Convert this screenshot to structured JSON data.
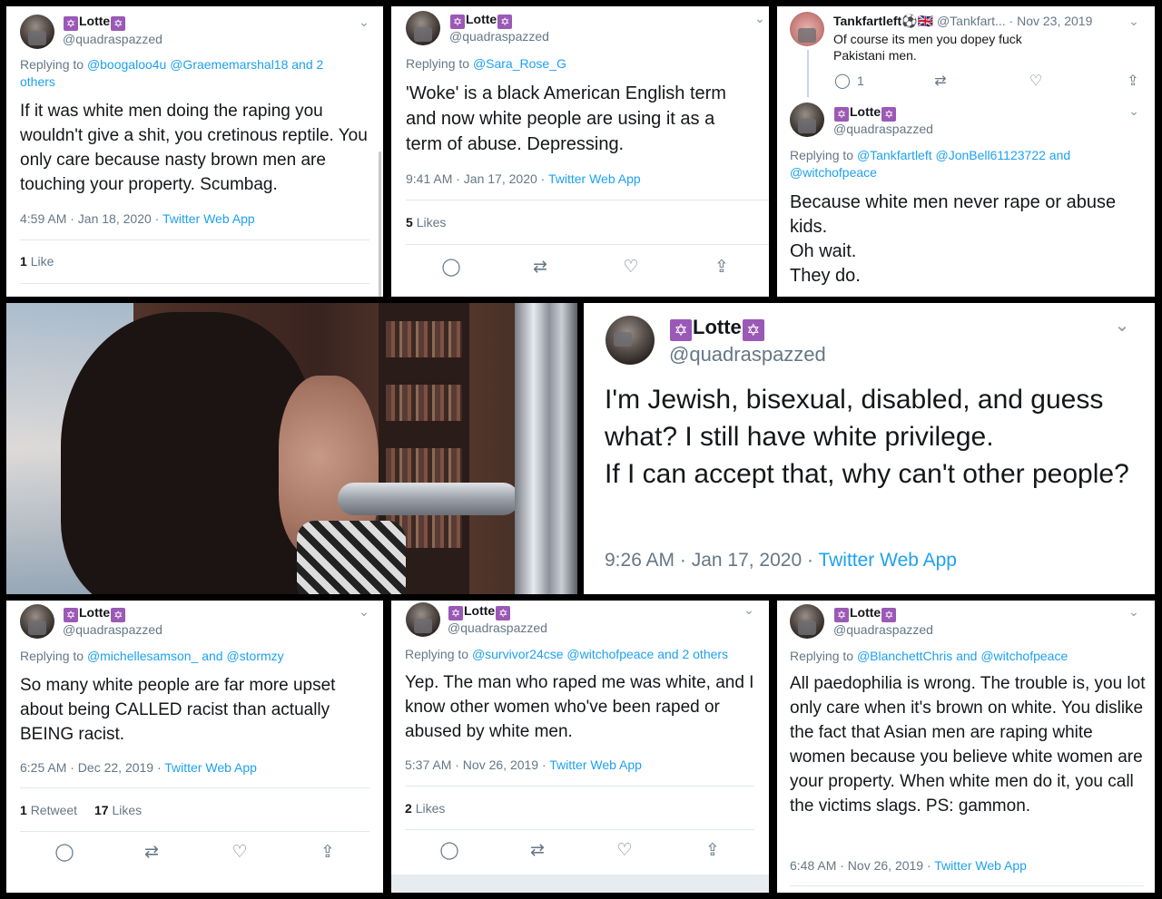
{
  "colors": {
    "link": "#1da1f2",
    "muted": "#657786",
    "text": "#14171a",
    "star_badge": "#9b59b6"
  },
  "profile": {
    "name": "Lotte",
    "handle": "@quadraspazzed",
    "star": "✡"
  },
  "tweets": {
    "t1": {
      "reply_prefix": "Replying to",
      "reply_to": "@boogaloo4u @Graememarshal18 and 2 others",
      "text": "If it was white men doing the raping you wouldn't give a shit, you cretinous reptile. You only care because nasty brown men are touching your property. Scumbag.",
      "time": "4:59 AM · Jan 18, 2020 ·",
      "app": "Twitter Web App",
      "likes_count": "1",
      "likes_label": "Like"
    },
    "t2": {
      "reply_prefix": "Replying to",
      "reply_to": "@Sara_Rose_G",
      "text": "'Woke' is a black American English term and now white people are using it as a term of abuse. Depressing.",
      "time": "9:41 AM · Jan 17, 2020 ·",
      "app": "Twitter Web App",
      "likes_count": "5",
      "likes_label": "Likes"
    },
    "t3": {
      "parent_name": "Tankfartleft",
      "parent_flags": "⚽🇬🇧",
      "parent_handle": "@Tankfart...",
      "parent_date": "· Nov 23, 2019",
      "parent_text": "Of course its men you dopey fuck Pakistani men.",
      "parent_reply_count": "1",
      "reply_prefix": "Replying to",
      "reply_to": "@Tankfartleft @JonBell61123722 and @witchofpeace",
      "text_lines": [
        "Because white men never rape or abuse kids.",
        "Oh wait.",
        "They do."
      ]
    },
    "t4": {
      "text_lines": [
        "I'm Jewish, bisexual, disabled, and guess what? I still have white privilege.",
        "If I can accept that, why can't other people?"
      ],
      "time": "9:26 AM · Jan 17, 2020 ·",
      "app": "Twitter Web App"
    },
    "t5": {
      "reply_prefix": "Replying to",
      "reply_to": "@michellesamson_ and @stormzy",
      "text": "So many white people are far more upset about being CALLED racist than actually BEING racist.",
      "time": "6:25 AM · Dec 22, 2019 ·",
      "app": "Twitter Web App",
      "retweets_count": "1",
      "retweets_label": "Retweet",
      "likes_count": "17",
      "likes_label": "Likes"
    },
    "t6": {
      "reply_prefix": "Replying to",
      "reply_to": "@survivor24cse @witchofpeace and 2 others",
      "text": "Yep. The man who raped me was white, and I know other women who've been raped or abused by white men.",
      "time": "5:37 AM · Nov 26, 2019 ·",
      "app": "Twitter Web App",
      "likes_count": "2",
      "likes_label": "Likes"
    },
    "t7": {
      "reply_prefix": "Replying to",
      "reply_to": "@BlanchettChris and @witchofpeace",
      "text": "All paedophilia is wrong. The trouble is, you lot only care when it's brown on white. You dislike the fact that Asian men are raping white women because you believe white women are your property. When white men do it, you call the victims slags. PS: gammon.",
      "time": "6:48 AM · Nov 26, 2019 ·",
      "app": "Twitter Web App"
    }
  },
  "icons": {
    "chevron": "chevron-down-icon",
    "reply": "reply-icon",
    "retweet": "retweet-icon",
    "like": "like-icon",
    "share": "share-icon"
  }
}
